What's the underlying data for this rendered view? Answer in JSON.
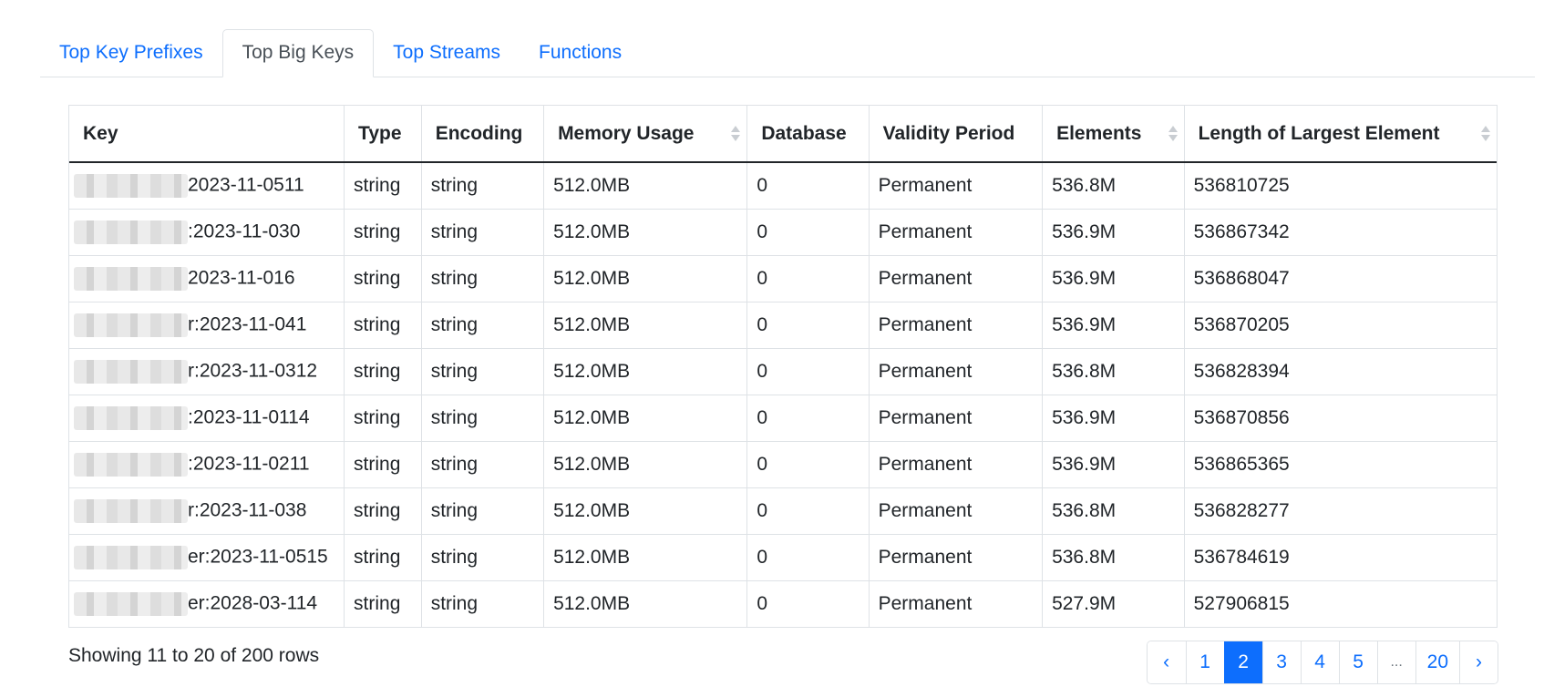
{
  "tabs": [
    {
      "label": "Top Key Prefixes",
      "active": false
    },
    {
      "label": "Top Big Keys",
      "active": true
    },
    {
      "label": "Top Streams",
      "active": false
    },
    {
      "label": "Functions",
      "active": false
    }
  ],
  "table": {
    "headers": [
      "Key",
      "Type",
      "Encoding",
      "Memory Usage",
      "Database",
      "Validity Period",
      "Elements",
      "Length of Largest Element"
    ],
    "sortable": [
      false,
      false,
      false,
      true,
      false,
      false,
      true,
      true
    ],
    "rows": [
      [
        "2023-11-0511",
        "string",
        "string",
        "512.0MB",
        "0",
        "Permanent",
        "536.8M",
        "536810725"
      ],
      [
        ":2023-11-030",
        "string",
        "string",
        "512.0MB",
        "0",
        "Permanent",
        "536.9M",
        "536867342"
      ],
      [
        "2023-11-016",
        "string",
        "string",
        "512.0MB",
        "0",
        "Permanent",
        "536.9M",
        "536868047"
      ],
      [
        "r:2023-11-041",
        "string",
        "string",
        "512.0MB",
        "0",
        "Permanent",
        "536.9M",
        "536870205"
      ],
      [
        "r:2023-11-0312",
        "string",
        "string",
        "512.0MB",
        "0",
        "Permanent",
        "536.8M",
        "536828394"
      ],
      [
        ":2023-11-0114",
        "string",
        "string",
        "512.0MB",
        "0",
        "Permanent",
        "536.9M",
        "536870856"
      ],
      [
        ":2023-11-0211",
        "string",
        "string",
        "512.0MB",
        "0",
        "Permanent",
        "536.9M",
        "536865365"
      ],
      [
        "r:2023-11-038",
        "string",
        "string",
        "512.0MB",
        "0",
        "Permanent",
        "536.8M",
        "536828277"
      ],
      [
        "er:2023-11-0515",
        "string",
        "string",
        "512.0MB",
        "0",
        "Permanent",
        "536.8M",
        "536784619"
      ],
      [
        "er:2028-03-114",
        "string",
        "string",
        "512.0MB",
        "0",
        "Permanent",
        "527.9M",
        "527906815"
      ]
    ]
  },
  "footer": {
    "showing": "Showing 11 to 20 of 200 rows"
  },
  "pagination": {
    "prev": "‹",
    "pages": [
      "1",
      "2",
      "3",
      "4",
      "5",
      "...",
      "20"
    ],
    "active": "2",
    "next": "›"
  },
  "colors": {
    "accent": "#0d6efd",
    "border": "#dee2e6",
    "text": "#212529"
  }
}
